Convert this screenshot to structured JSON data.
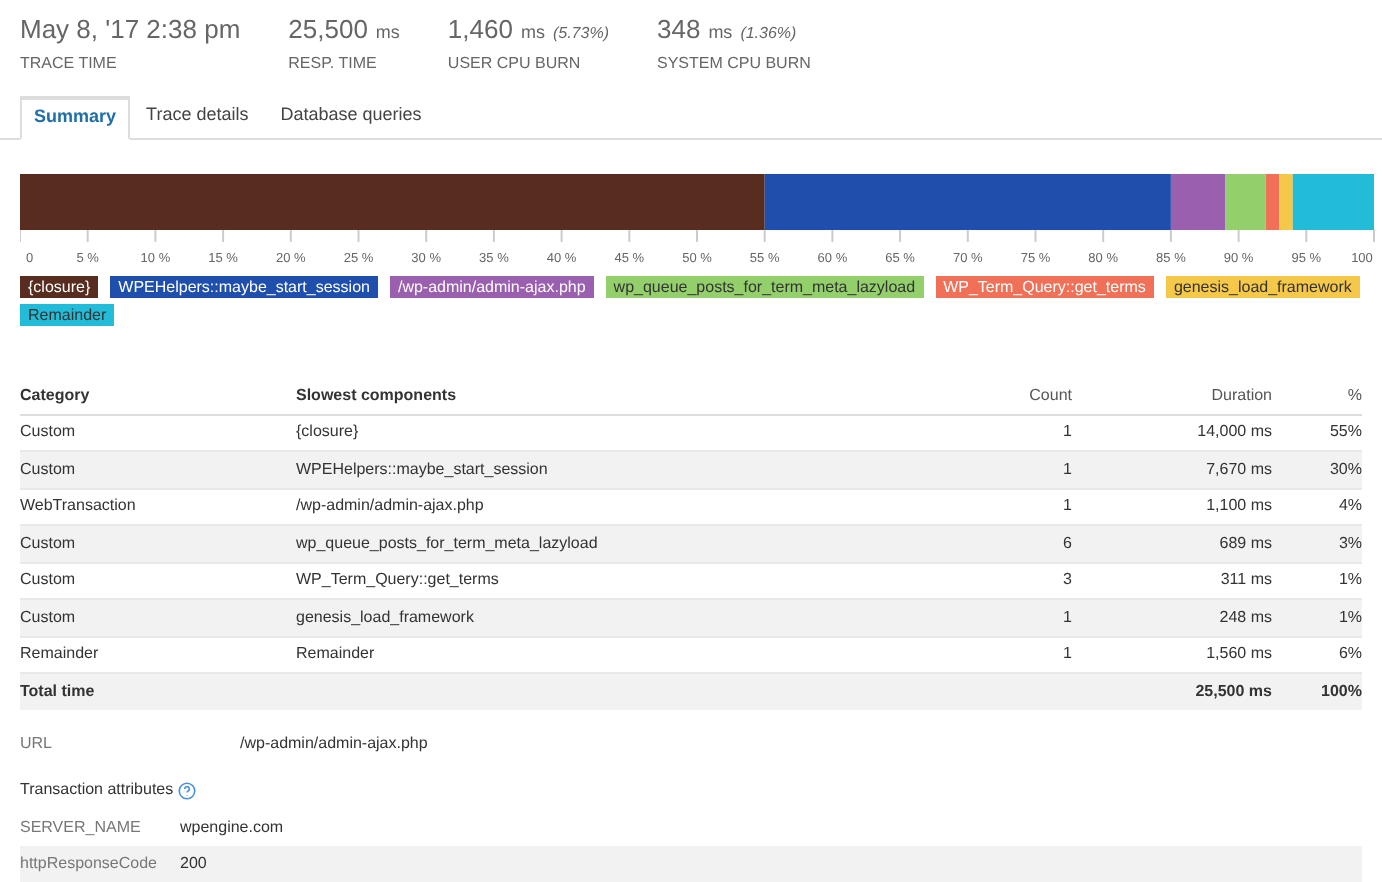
{
  "stats": [
    {
      "value": "May 8, '17 2:38 pm",
      "label": "TRACE TIME"
    },
    {
      "value": "25,500",
      "unit": "ms",
      "label": "RESP. TIME"
    },
    {
      "value": "1,460",
      "unit": "ms",
      "note": "(5.73%)",
      "label": "USER CPU BURN"
    },
    {
      "value": "348",
      "unit": "ms",
      "note": "(1.36%)",
      "label": "SYSTEM CPU BURN"
    }
  ],
  "tabs": [
    {
      "label": "Summary",
      "selected": true
    },
    {
      "label": "Trace details",
      "selected": false
    },
    {
      "label": "Database queries",
      "selected": false
    }
  ],
  "chart_data": {
    "type": "bar",
    "orientation": "horizontal",
    "stacked": true,
    "xlim": [
      0,
      100
    ],
    "xticks": [
      {
        "value": 0,
        "label": "0"
      },
      {
        "value": 5,
        "label": "5 %"
      },
      {
        "value": 10,
        "label": "10 %"
      },
      {
        "value": 15,
        "label": "15 %"
      },
      {
        "value": 20,
        "label": "20 %"
      },
      {
        "value": 25,
        "label": "25 %"
      },
      {
        "value": 30,
        "label": "30 %"
      },
      {
        "value": 35,
        "label": "35 %"
      },
      {
        "value": 40,
        "label": "40 %"
      },
      {
        "value": 45,
        "label": "45 %"
      },
      {
        "value": 50,
        "label": "50 %"
      },
      {
        "value": 55,
        "label": "55 %"
      },
      {
        "value": 60,
        "label": "60 %"
      },
      {
        "value": 65,
        "label": "65 %"
      },
      {
        "value": 70,
        "label": "70 %"
      },
      {
        "value": 75,
        "label": "75 %"
      },
      {
        "value": 80,
        "label": "80 %"
      },
      {
        "value": 85,
        "label": "85 %"
      },
      {
        "value": 90,
        "label": "90 %"
      },
      {
        "value": 95,
        "label": "95 %"
      },
      {
        "value": 100,
        "label": "100"
      }
    ],
    "series": [
      {
        "name": "{closure}",
        "color": "#582c1f",
        "values": [
          55
        ]
      },
      {
        "name": "WPEHelpers::maybe_start_session",
        "color": "#1f4fad",
        "values": [
          30
        ]
      },
      {
        "name": "/wp-admin/admin-ajax.php",
        "color": "#9b5fb0",
        "values": [
          4
        ]
      },
      {
        "name": "wp_queue_posts_for_term_meta_lazyload",
        "color": "#93d06c",
        "values": [
          3
        ]
      },
      {
        "name": "WP_Term_Query::get_terms",
        "color": "#f07058",
        "values": [
          1
        ]
      },
      {
        "name": "genesis_load_framework",
        "color": "#f5c84a",
        "values": [
          1
        ]
      },
      {
        "name": "Remainder",
        "color": "#22bcd8",
        "values": [
          6
        ]
      }
    ]
  },
  "table": {
    "columns": [
      "Category",
      "Slowest components",
      "Count",
      "Duration",
      "%"
    ],
    "rows": [
      [
        "Custom",
        "{closure}",
        "1",
        "14,000 ms",
        "55%"
      ],
      [
        "Custom",
        "WPEHelpers::maybe_start_session",
        "1",
        "7,670 ms",
        "30%"
      ],
      [
        "WebTransaction",
        "/wp-admin/admin-ajax.php",
        "1",
        "1,100 ms",
        "4%"
      ],
      [
        "Custom",
        "wp_queue_posts_for_term_meta_lazyload",
        "6",
        "689 ms",
        "3%"
      ],
      [
        "Custom",
        "WP_Term_Query::get_terms",
        "3",
        "311 ms",
        "1%"
      ],
      [
        "Custom",
        "genesis_load_framework",
        "1",
        "248 ms",
        "1%"
      ],
      [
        "Remainder",
        "Remainder",
        "1",
        "1,560 ms",
        "6%"
      ]
    ],
    "total": {
      "label": "Total time",
      "duration": "25,500 ms",
      "percent": "100%"
    }
  },
  "url": {
    "label": "URL",
    "value": "/wp-admin/admin-ajax.php"
  },
  "attributes": {
    "title": "Transaction attributes",
    "rows": [
      [
        "SERVER_NAME",
        "wpengine.com"
      ],
      [
        "httpResponseCode",
        "200"
      ]
    ]
  }
}
